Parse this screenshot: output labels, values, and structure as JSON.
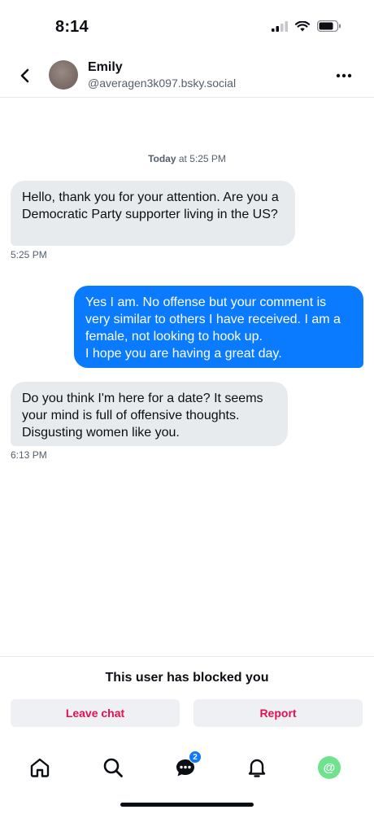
{
  "status_bar": {
    "time": "8:14"
  },
  "header": {
    "name": "Emily",
    "handle": "@averagen3k097.bsky.social"
  },
  "conversation": {
    "date_label_bold": "Today",
    "date_label_rest": " at 5:25 PM",
    "messages": [
      {
        "direction": "incoming",
        "text": "Hello, thank you for your attention. Are you a Democratic Party supporter living in the US?",
        "time": "5:25 PM"
      },
      {
        "direction": "outgoing",
        "text_lines": [
          "Yes I am. No offense but your comment is very similar to others I have received. I am a female, not looking to hook up.",
          "I hope you are having a great day."
        ]
      },
      {
        "direction": "incoming",
        "text": "Do you think I'm here for a date? It seems your mind is full of offensive thoughts. Disgusting women like you.",
        "time": "6:13 PM"
      }
    ]
  },
  "blocked_notice": {
    "text": "This user has blocked you",
    "leave_label": "Leave chat",
    "report_label": "Report"
  },
  "tab_bar": {
    "chat_badge": "2",
    "profile_glyph": "@"
  },
  "colors": {
    "accent": "#0a7aff",
    "danger": "#e0124f",
    "incoming_bubble": "#e8ebee",
    "profile_avatar": "#6ee28d"
  },
  "icons": [
    "signal-icon",
    "wifi-icon",
    "battery-icon",
    "back-chevron-icon",
    "more-icon",
    "home-icon",
    "search-icon",
    "chat-icon",
    "bell-icon",
    "profile-icon"
  ]
}
